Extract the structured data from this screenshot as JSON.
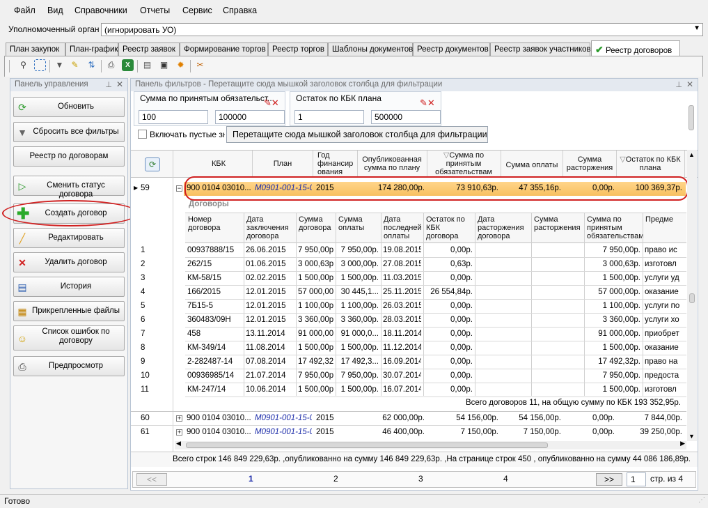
{
  "menu": [
    "Файл",
    "Вид",
    "Справочники",
    "Отчеты",
    "Сервис",
    "Справка"
  ],
  "org": {
    "label": "Уполномоченный орган",
    "value": "(игнорировать УО)"
  },
  "tabs": [
    "План закупок",
    "План-график",
    "Реестр заявок",
    "Формирование торгов",
    "Реестр торгов",
    "Шаблоны документов",
    "Реестр документов",
    "Реестр заявок участников",
    "Реестр договоров"
  ],
  "toolbar_icons": [
    "zoom-icon",
    "select-icon",
    "filter-icon",
    "clear-filter-icon",
    "sort-icon",
    "print-icon",
    "excel-icon",
    "export-icon",
    "save-icon",
    "settings-icon",
    "tools-icon"
  ],
  "left_panel": {
    "title": "Панель управления",
    "buttons": [
      {
        "label": "Обновить",
        "icon": "refresh-icon"
      },
      {
        "label": "Сбросить все фильтры",
        "icon": "funnel-icon"
      },
      {
        "label": "Реестр по договорам",
        "icon": ""
      },
      {
        "label": "Сменить статус договора",
        "icon": "status-icon"
      },
      {
        "label": "Создать договор",
        "icon": "plus-icon"
      },
      {
        "label": "Редактировать",
        "icon": "pencil-icon"
      },
      {
        "label": "Удалить договор",
        "icon": "delete-icon"
      },
      {
        "label": "История",
        "icon": "history-icon"
      },
      {
        "label": "Прикрепленные файлы",
        "icon": "files-icon"
      },
      {
        "label": "Список ошибок по договору",
        "icon": "errors-icon"
      },
      {
        "label": "Предпросмотр",
        "icon": "preview-icon"
      }
    ]
  },
  "filter_panel": {
    "title": "Панель фильтров - Перетащите сюда мышкой заголовок столбца для фильтрации",
    "group1": {
      "title": "Сумма по принятым обязательст...",
      "from": "100",
      "to": "100000"
    },
    "group2": {
      "title": "Остаток по КБК плана",
      "from": "1",
      "to": "500000"
    },
    "include_empty": "Включать пустые значения",
    "drag_tip": "Перетащите сюда мышкой заголовок столбца для фильтрации"
  },
  "master_headers": [
    "КБК",
    "План",
    "Год финансир ования",
    "Опубликованная сумма по плану",
    "Сумма по принятым обязательствам",
    "Сумма оплаты",
    "Сумма расторжения",
    "Остаток по КБК плана"
  ],
  "master_rows": [
    {
      "num": "59",
      "kbk": "900 0104 03010...",
      "plan": "M0901-001-15-0",
      "year": "2015",
      "pub": "174 280,00р.",
      "accepted": "73 910,63р.",
      "paid": "47 355,16р.",
      "term": "0,00р.",
      "rest": "100 369,37р."
    },
    {
      "num": "60",
      "kbk": "900 0104 03010...",
      "plan": "M0901-001-15-0",
      "year": "2015",
      "pub": "62 000,00р.",
      "accepted": "54 156,00р.",
      "paid": "54 156,00р.",
      "term": "0,00р.",
      "rest": "7 844,00р."
    },
    {
      "num": "61",
      "kbk": "900 0104 03010...",
      "plan": "M0901-001-15-0",
      "year": "2015",
      "pub": "46 400,00р.",
      "accepted": "7 150,00р.",
      "paid": "7 150,00р.",
      "term": "0,00р.",
      "rest": "39 250,00р."
    }
  ],
  "detail": {
    "title": "Договоры",
    "headers": [
      "Номер договора",
      "Дата заключения договора",
      "Сумма договора",
      "Сумма оплаты",
      "Дата последней оплаты",
      "Остаток по КБК договора",
      "Дата расторжения договора",
      "Сумма расторжения",
      "Сумма по принятым обязательствам",
      "Предме"
    ],
    "rows": [
      [
        "1",
        "00937888/15",
        "26.06.2015",
        "7 950,00р.",
        "7 950,00р.",
        "19.08.2015",
        "0,00р.",
        "",
        "",
        "7 950,00р.",
        "право ис"
      ],
      [
        "2",
        "262/15",
        "01.06.2015",
        "3 000,63р.",
        "3 000,00р.",
        "27.08.2015",
        "0,63р.",
        "",
        "",
        "3 000,63р.",
        "изготовл"
      ],
      [
        "3",
        "КМ-58/15",
        "02.02.2015",
        "1 500,00р.",
        "1 500,00р.",
        "11.03.2015",
        "0,00р.",
        "",
        "",
        "1 500,00р.",
        "услуги уд"
      ],
      [
        "4",
        "166/2015",
        "12.01.2015",
        "57 000,00р.",
        "30 445,1...",
        "25.11.2015",
        "26 554,84р.",
        "",
        "",
        "57 000,00р.",
        "оказание"
      ],
      [
        "5",
        "7Б15-5",
        "12.01.2015",
        "1 100,00р.",
        "1 100,00р.",
        "26.03.2015",
        "0,00р.",
        "",
        "",
        "1 100,00р.",
        "услуги по"
      ],
      [
        "6",
        "360483/09Н",
        "12.01.2015",
        "3 360,00р.",
        "3 360,00р.",
        "28.03.2015",
        "0,00р.",
        "",
        "",
        "3 360,00р.",
        "услуги хо"
      ],
      [
        "7",
        "458",
        "13.11.2014",
        "91 000,00р.",
        "91 000,0...",
        "18.11.2014",
        "0,00р.",
        "",
        "",
        "91 000,00р.",
        "приобрет"
      ],
      [
        "8",
        "КМ-349/14",
        "11.08.2014",
        "1 500,00р.",
        "1 500,00р.",
        "11.12.2014",
        "0,00р.",
        "",
        "",
        "1 500,00р.",
        "оказание"
      ],
      [
        "9",
        "2-282487-14",
        "07.08.2014",
        "17 492,32р.",
        "17 492,3...",
        "16.09.2014",
        "0,00р.",
        "",
        "",
        "17 492,32р.",
        "право на"
      ],
      [
        "10",
        "00936985/14",
        "21.07.2014",
        "7 950,00р.",
        "7 950,00р.",
        "30.07.2014",
        "0,00р.",
        "",
        "",
        "7 950,00р.",
        "предоста"
      ],
      [
        "11",
        "КМ-247/14",
        "10.06.2014",
        "1 500,00р.",
        "1 500,00р.",
        "16.07.2014",
        "0,00р.",
        "",
        "",
        "1 500,00р.",
        "изготовл"
      ]
    ],
    "summary": "Всего договоров 11, на общую сумму по КБК 193 352,95р."
  },
  "total": "Всего строк 146 849 229,63р. ,опубликованно на сумму 146 849 229,63р. ,На странице строк 450 , опубликованно на сумму 44 086 186,89р.",
  "pager": {
    "prev": "<<",
    "next": ">>",
    "pages": [
      "1",
      "2",
      "3",
      "4"
    ],
    "current": "1",
    "of": "стр. из 4"
  },
  "status": "Готово",
  "colors": {
    "highlight": "#f8c060",
    "annotation": "#d02020",
    "link": "#1a2aa8"
  }
}
